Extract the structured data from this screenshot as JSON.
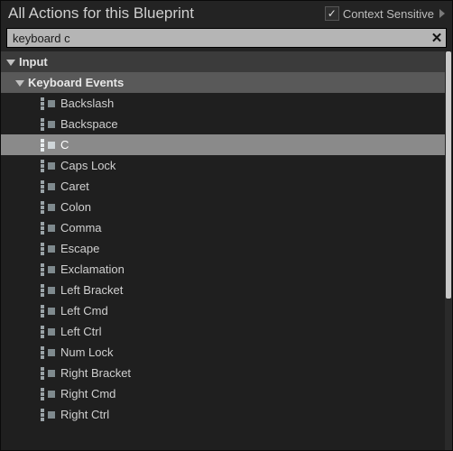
{
  "header": {
    "title": "All Actions for this Blueprint",
    "context_label": "Context Sensitive",
    "context_checked": true
  },
  "search": {
    "value": "keyboard c",
    "clear_glyph": "✕"
  },
  "tree": {
    "category": "Input",
    "subcategory": "Keyboard Events",
    "items": [
      {
        "label": "Backslash",
        "selected": false
      },
      {
        "label": "Backspace",
        "selected": false
      },
      {
        "label": "C",
        "selected": true
      },
      {
        "label": "Caps Lock",
        "selected": false
      },
      {
        "label": "Caret",
        "selected": false
      },
      {
        "label": "Colon",
        "selected": false
      },
      {
        "label": "Comma",
        "selected": false
      },
      {
        "label": "Escape",
        "selected": false
      },
      {
        "label": "Exclamation",
        "selected": false
      },
      {
        "label": "Left Bracket",
        "selected": false
      },
      {
        "label": "Left Cmd",
        "selected": false
      },
      {
        "label": "Left Ctrl",
        "selected": false
      },
      {
        "label": "Num Lock",
        "selected": false
      },
      {
        "label": "Right Bracket",
        "selected": false
      },
      {
        "label": "Right Cmd",
        "selected": false
      },
      {
        "label": "Right Ctrl",
        "selected": false
      }
    ]
  }
}
